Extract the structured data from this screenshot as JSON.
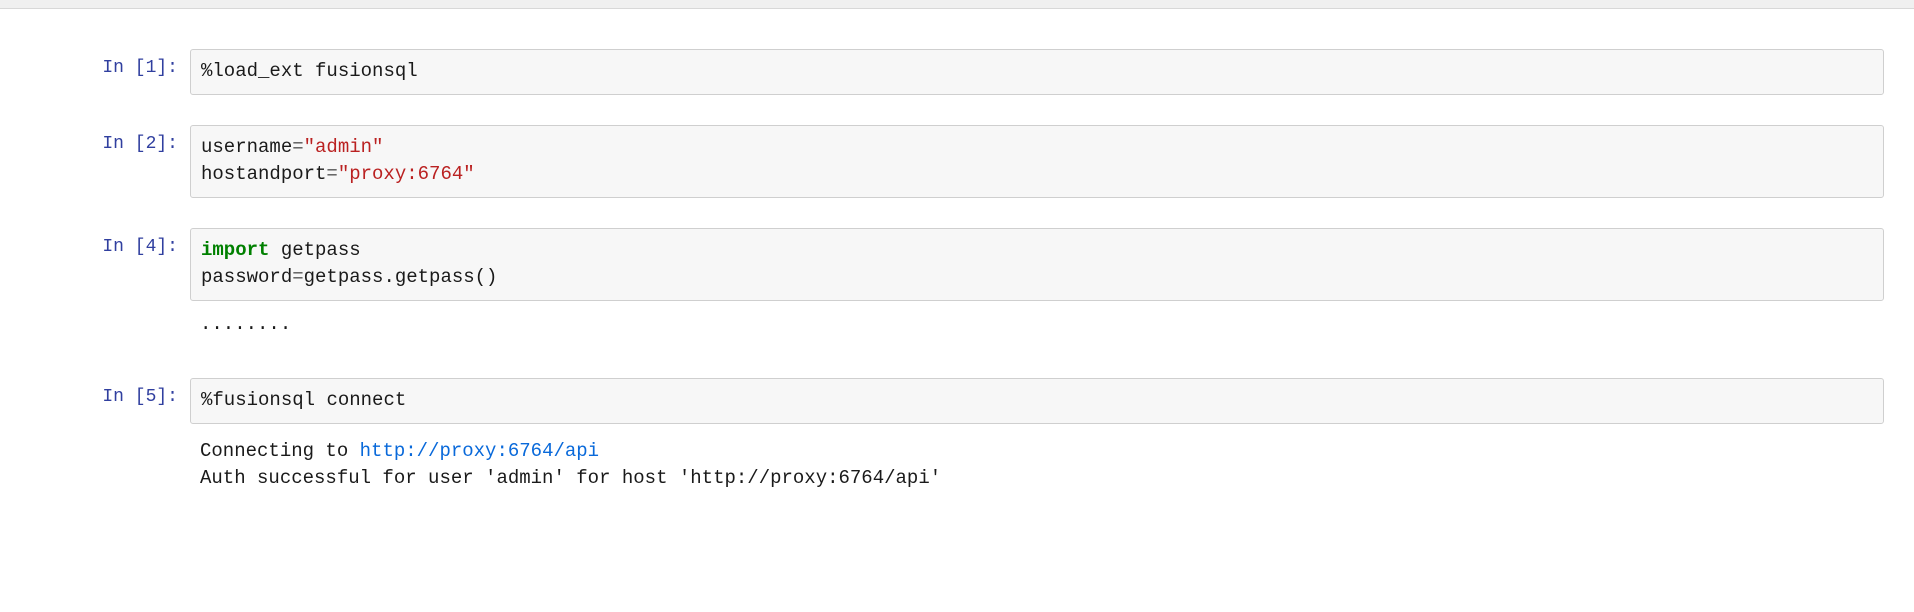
{
  "cells": [
    {
      "prompt_label": "In [1]:",
      "code": {
        "line1_magic": "%load_ext",
        "line1_space": " ",
        "line1_arg": "fusionsql"
      }
    },
    {
      "prompt_label": "In [2]:",
      "code": {
        "line1_var": "username",
        "line1_eq": "=",
        "line1_str": "\"admin\"",
        "line2_var": "hostandport",
        "line2_eq": "=",
        "line2_str": "\"proxy:6764\""
      }
    },
    {
      "prompt_label": "In [4]:",
      "code": {
        "line1_kw": "import",
        "line1_sp": " ",
        "line1_mod": "getpass",
        "line2_var": "password",
        "line2_eq": "=",
        "line2_call": "getpass.getpass()"
      },
      "output": {
        "text": "········"
      }
    },
    {
      "prompt_label": "In [5]:",
      "code": {
        "line1_magic": "%fusionsql",
        "line1_sp": " ",
        "line1_arg": "connect"
      },
      "output": {
        "line1_pre": "Connecting to ",
        "line1_link": "http://proxy:6764/api",
        "line2": "Auth successful for user 'admin' for host 'http://proxy:6764/api'"
      }
    }
  ]
}
